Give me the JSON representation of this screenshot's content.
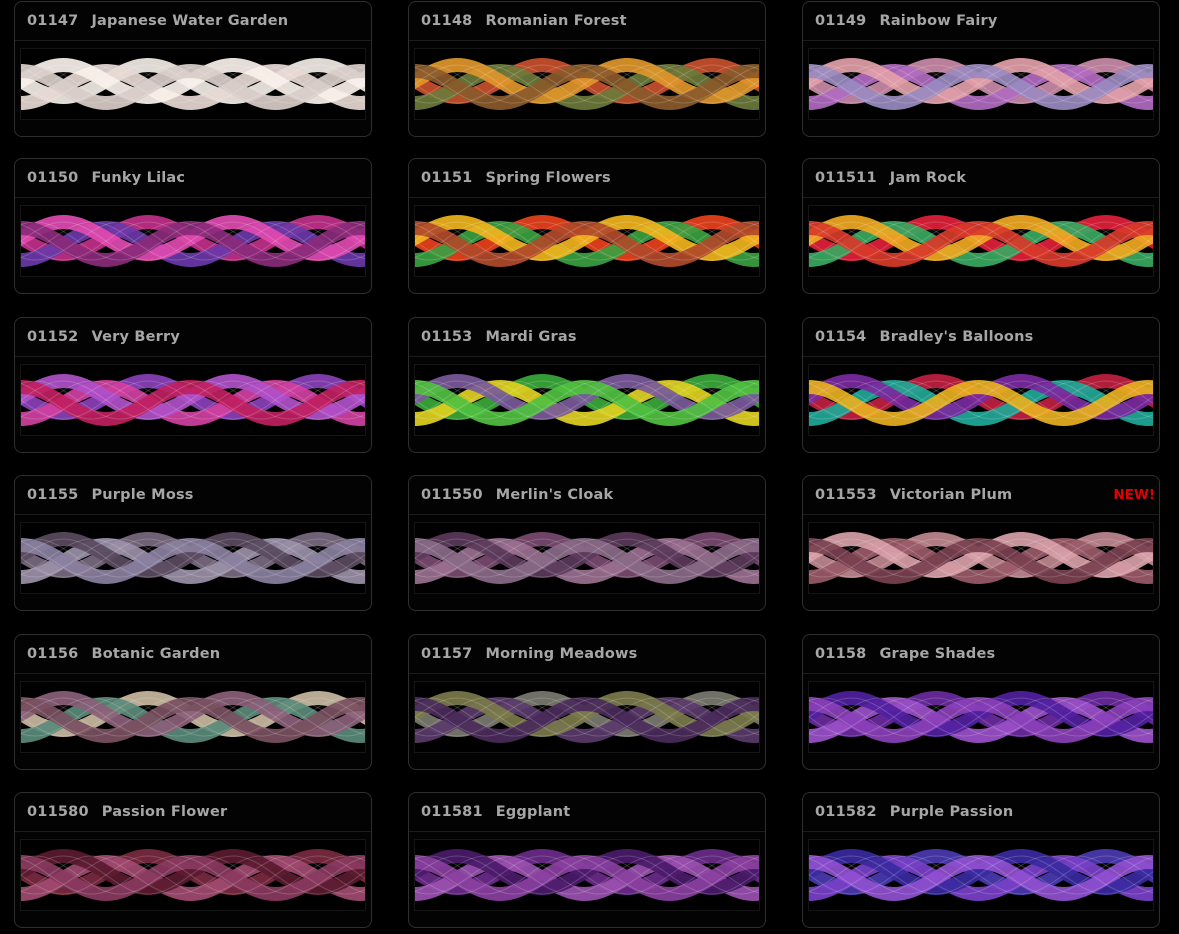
{
  "products": [
    {
      "code": "01147",
      "name": "Japanese Water Garden",
      "badge": "",
      "colors": [
        "#f2ece6",
        "#e6d8d2",
        "#f8f0ea",
        "#d8ccc8"
      ]
    },
    {
      "code": "01148",
      "name": "Romanian Forest",
      "badge": "",
      "colors": [
        "#c8502c",
        "#6b7a3a",
        "#e0962a",
        "#8a5a2a"
      ]
    },
    {
      "code": "01149",
      "name": "Rainbow Fairy",
      "badge": "",
      "colors": [
        "#c98aa8",
        "#b06ac0",
        "#e2a0a8",
        "#9a8ac0"
      ]
    },
    {
      "code": "01150",
      "name": "Funky Lilac",
      "badge": "",
      "colors": [
        "#c0308a",
        "#6a38a8",
        "#e04ab0",
        "#8a2a7a"
      ]
    },
    {
      "code": "01151",
      "name": "Spring Flowers",
      "badge": "",
      "colors": [
        "#e8401c",
        "#3aa040",
        "#f0b41c",
        "#b04a2a"
      ]
    },
    {
      "code": "011511",
      "name": "Jam Rock",
      "badge": "",
      "colors": [
        "#e02038",
        "#38a860",
        "#f0a820",
        "#d83a2a"
      ]
    },
    {
      "code": "01152",
      "name": "Very Berry",
      "badge": "",
      "colors": [
        "#8a40b8",
        "#d040a0",
        "#b050c8",
        "#c02060"
      ]
    },
    {
      "code": "01153",
      "name": "Mardi Gras",
      "badge": "",
      "colors": [
        "#3aa83a",
        "#e0d020",
        "#7a5a9a",
        "#50c040"
      ]
    },
    {
      "code": "01154",
      "name": "Bradley's Balloons",
      "badge": "",
      "colors": [
        "#c02040",
        "#20a898",
        "#7a2aa0",
        "#e8b020"
      ]
    },
    {
      "code": "01155",
      "name": "Purple Moss",
      "badge": "",
      "colors": [
        "#7a6a80",
        "#9a90a8",
        "#5a4a60",
        "#8a80a0"
      ]
    },
    {
      "code": "011550",
      "name": "Merlin's Cloak",
      "badge": "",
      "colors": [
        "#7a4a70",
        "#9a7090",
        "#5a3a5a",
        "#8a6a88"
      ]
    },
    {
      "code": "011553",
      "name": "Victorian Plum",
      "badge": "NEW!",
      "colors": [
        "#c08890",
        "#9a5a68",
        "#d8a0a8",
        "#7a4050"
      ]
    },
    {
      "code": "01156",
      "name": "Botanic Garden",
      "badge": "",
      "colors": [
        "#c8b8a0",
        "#5a8a7a",
        "#8a6078",
        "#7a5060"
      ]
    },
    {
      "code": "01157",
      "name": "Morning Meadows",
      "badge": "",
      "colors": [
        "#7a7a70",
        "#5a3a6a",
        "#7a7a4a",
        "#4a2a5a"
      ]
    },
    {
      "code": "01158",
      "name": "Grape Shades",
      "badge": "",
      "colors": [
        "#6a2aa0",
        "#9a50c8",
        "#5020a0",
        "#8a40b8"
      ]
    },
    {
      "code": "011580",
      "name": "Passion Flower",
      "badge": "",
      "colors": [
        "#7a2a40",
        "#a04a70",
        "#5a1a30",
        "#8a3a60"
      ]
    },
    {
      "code": "011581",
      "name": "Eggplant",
      "badge": "",
      "colors": [
        "#6a2a8a",
        "#9a50b0",
        "#4a1a6a",
        "#8a40a0"
      ]
    },
    {
      "code": "011582",
      "name": "Purple Passion",
      "badge": "",
      "colors": [
        "#4a3ab0",
        "#7a40c8",
        "#3a2aa0",
        "#9050d0"
      ]
    }
  ]
}
